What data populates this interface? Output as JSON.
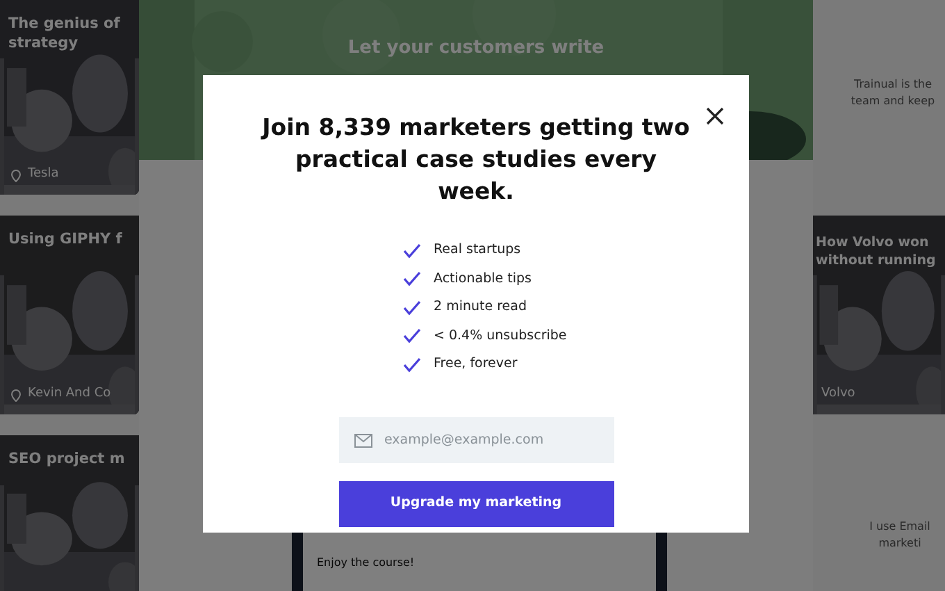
{
  "background_page": {
    "left_cards": [
      {
        "title_lines": [
          "The genius of",
          "strategy"
        ],
        "author": "Tesla"
      },
      {
        "title_lines": [
          "Using GIPHY f"
        ],
        "author": "Kevin And Co"
      },
      {
        "title_lines": [
          "SEO project m"
        ]
      }
    ],
    "hero": {
      "title_lines": [
        "Let your customers write"
      ]
    },
    "phone_text": "Enjoy the course!",
    "right_blurb_lines": [
      "Trainual is the",
      "team and keep"
    ],
    "right_card": {
      "title_lines": [
        "How Volvo won",
        "without running"
      ],
      "author": "Volvo"
    },
    "right_quote_lines": [
      "I use Email",
      "marketi"
    ]
  },
  "modal": {
    "title": "Join 8,339 marketers getting two practical case studies every week.",
    "features": [
      {
        "label": "Real startups",
        "checked": true
      },
      {
        "label": "Actionable tips",
        "checked": true
      },
      {
        "label": "2 minute read",
        "checked": true
      },
      {
        "label": "< 0.4% unsubscribe",
        "checked": true
      },
      {
        "label": "Free, forever",
        "checked": true
      }
    ],
    "email": {
      "placeholder": "example@example.com"
    },
    "button": "Upgrade my marketing"
  }
}
